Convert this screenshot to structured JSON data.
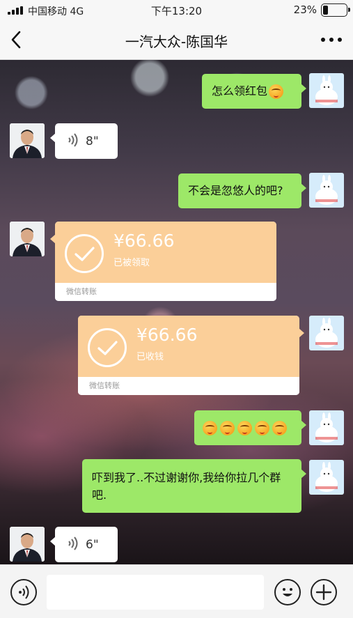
{
  "status_bar": {
    "carrier": "中国移动 4G",
    "time": "下午13:20",
    "battery": "23%"
  },
  "nav": {
    "title": "一汽大众-陈国华"
  },
  "messages": {
    "m1_text": "怎么领红包",
    "m2_voice": "8\"",
    "m3_text": "不会是忽悠人的吧?",
    "m4_amount": "¥66.66",
    "m4_status": "已被领取",
    "m4_footer": "微信转账",
    "m5_amount": "¥66.66",
    "m5_status": "已收钱",
    "m5_footer": "微信转账",
    "m7_text": "吓到我了..不过谢谢你,我给你拉几个群吧.",
    "m8_voice": "6\""
  },
  "input": {
    "value": "",
    "placeholder": ""
  },
  "colors": {
    "self_bubble": "#9de868",
    "transfer_card": "#fbcf99",
    "other_bubble": "#ffffff"
  }
}
